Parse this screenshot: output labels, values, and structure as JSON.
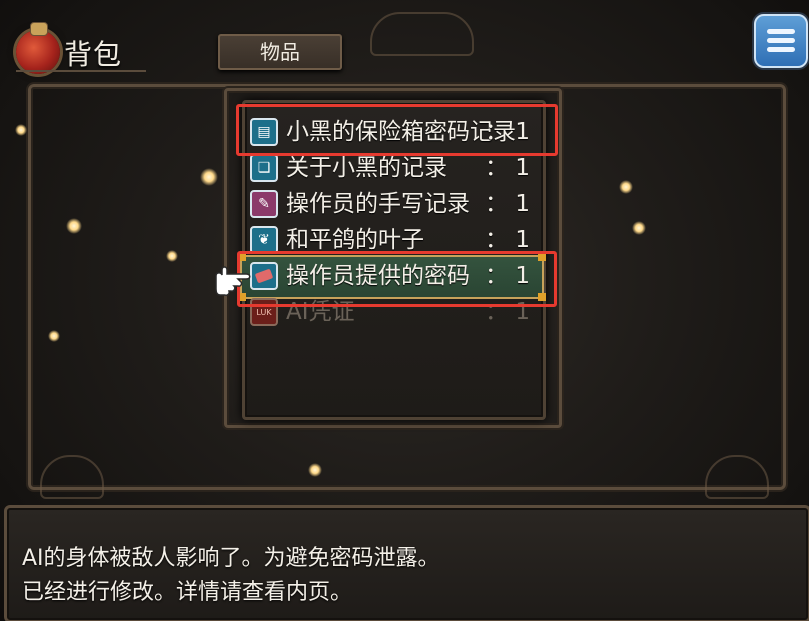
{
  "header": {
    "bag_title": "背包",
    "tab_label": "物品"
  },
  "item_list": [
    {
      "name": "小黑的保险箱密码记录",
      "separator": "：",
      "qty": "1",
      "icon": "document-icon",
      "icon_color": "#1d6f8a"
    },
    {
      "name": "关于小黑的记录 ",
      "separator": "：",
      "qty": "1",
      "icon": "book-icon",
      "icon_color": "#1d6f8a"
    },
    {
      "name": "操作员的手写记录",
      "separator": "：",
      "qty": "1",
      "icon": "feather-note-icon",
      "icon_color": "#8b3a6a"
    },
    {
      "name": "和平鸽的叶子 ",
      "separator": "：",
      "qty": "1",
      "icon": "palm-leaf-icon",
      "icon_color": "#1d6f8a"
    },
    {
      "name": "操作员提供的密码",
      "separator": "：",
      "qty": "1",
      "icon": "red-book-icon",
      "icon_color": "#1d6f8a"
    },
    {
      "name": "AI凭证",
      "separator": "：",
      "qty": "1",
      "icon": "luk-badge-icon",
      "icon_color": "#6b1f1a",
      "icon_text": "LUK"
    }
  ],
  "selected_index": 4,
  "description": {
    "line1": "AI的身体被敌人影响了。为避免密码泄露。",
    "line2": "已经进行修改。详情请查看内页。"
  },
  "colors": {
    "highlight": "#e63a2f",
    "selection_border": "#c7a25a",
    "selection_fill": "#2f4c38",
    "menu_button": "#3f84c8"
  }
}
